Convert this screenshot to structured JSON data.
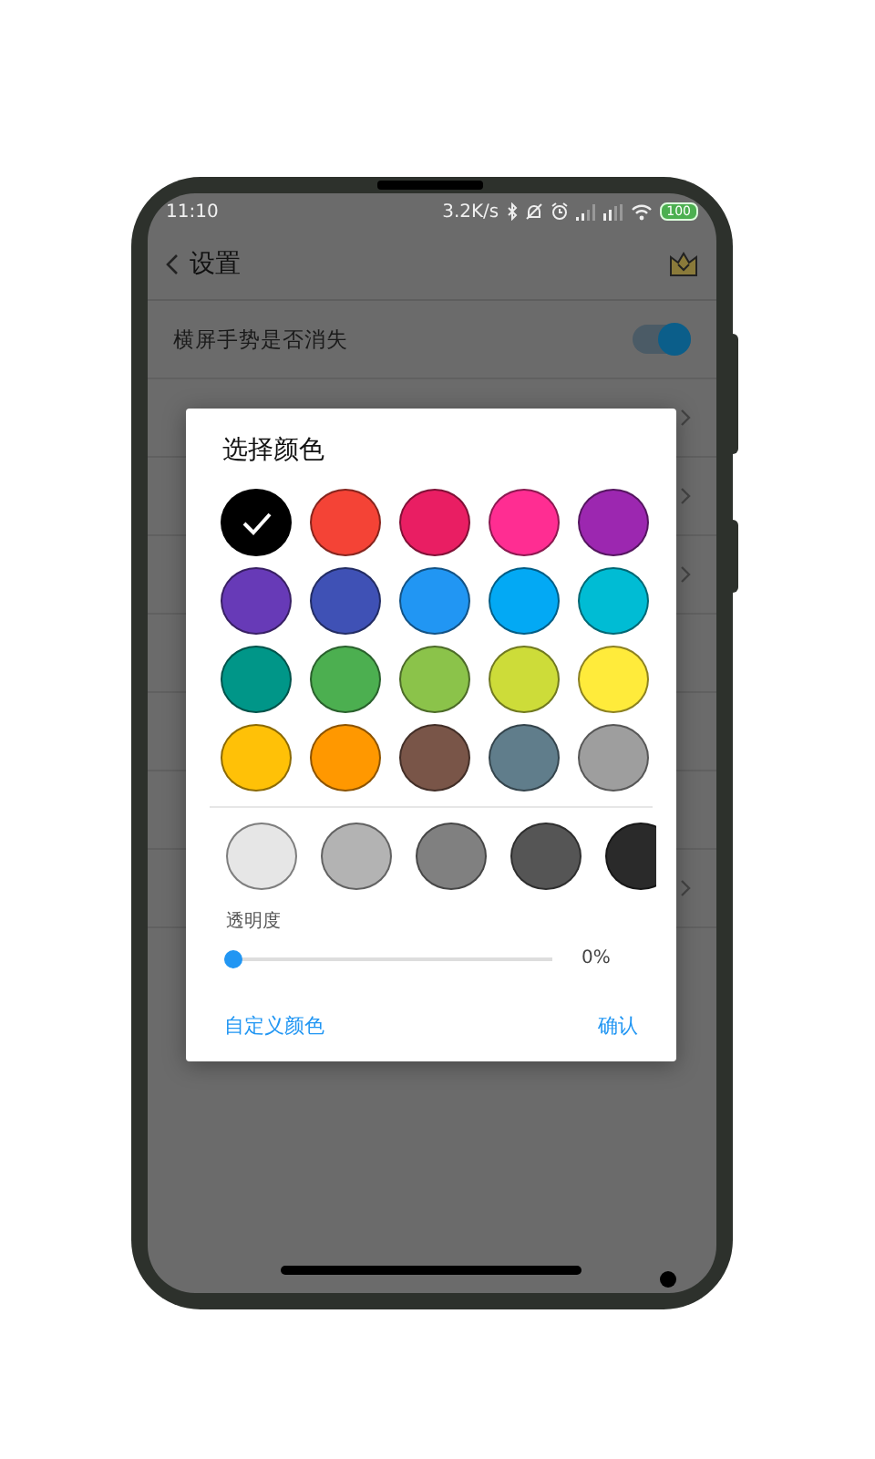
{
  "status_bar": {
    "time": "11:10",
    "speed": "3.2K/s",
    "battery": "100"
  },
  "header": {
    "title": "设置"
  },
  "settings": [
    {
      "kind": "toggle",
      "label": "横屏手势是否消失",
      "on": true
    },
    {
      "kind": "link"
    },
    {
      "kind": "link"
    },
    {
      "kind": "link"
    },
    {
      "kind": "plain"
    },
    {
      "kind": "plain"
    },
    {
      "kind": "plain"
    },
    {
      "kind": "link"
    }
  ],
  "dialog": {
    "title": "选择颜色",
    "colors": [
      {
        "color": "#000000",
        "selected": true
      },
      {
        "color": "#f44336",
        "selected": false
      },
      {
        "color": "#e91e63",
        "selected": false
      },
      {
        "color": "#ff2d92",
        "selected": false
      },
      {
        "color": "#9c27b0",
        "selected": false
      },
      {
        "color": "#673ab7",
        "selected": false
      },
      {
        "color": "#3f51b5",
        "selected": false
      },
      {
        "color": "#2196f3",
        "selected": false
      },
      {
        "color": "#03a9f4",
        "selected": false
      },
      {
        "color": "#00bcd4",
        "selected": false
      },
      {
        "color": "#009688",
        "selected": false
      },
      {
        "color": "#4caf50",
        "selected": false
      },
      {
        "color": "#8bc34a",
        "selected": false
      },
      {
        "color": "#cddc39",
        "selected": false
      },
      {
        "color": "#ffeb3b",
        "selected": false
      },
      {
        "color": "#ffc107",
        "selected": false
      },
      {
        "color": "#ff9800",
        "selected": false
      },
      {
        "color": "#795548",
        "selected": false
      },
      {
        "color": "#607d8b",
        "selected": false
      },
      {
        "color": "#9e9e9e",
        "selected": false
      }
    ],
    "shades": [
      {
        "color": "#e6e6e6",
        "selected": false
      },
      {
        "color": "#b3b3b3",
        "selected": false
      },
      {
        "color": "#808080",
        "selected": false
      },
      {
        "color": "#555555",
        "selected": false
      },
      {
        "color": "#2a2a2a",
        "selected": false
      }
    ],
    "opacity": {
      "label": "透明度",
      "level": 0,
      "reading": "0%"
    },
    "buttons": [
      "自定义颜色",
      "确认"
    ]
  }
}
